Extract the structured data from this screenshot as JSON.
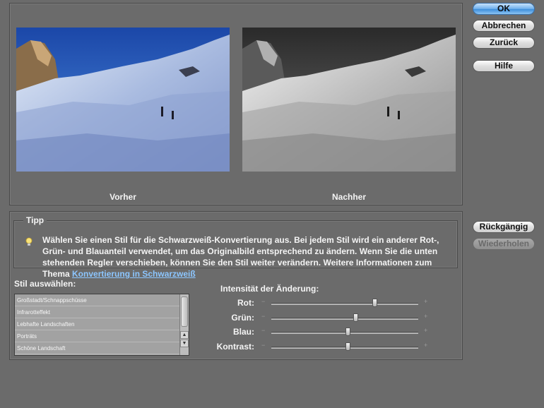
{
  "buttons": {
    "ok": "OK",
    "cancel": "Abbrechen",
    "back": "Zurück",
    "help": "Hilfe",
    "undo": "Rückgängig",
    "redo": "Wiederholen"
  },
  "preview": {
    "before_label": "Vorher",
    "after_label": "Nachher"
  },
  "tip": {
    "title": "Tipp",
    "text": "Wählen Sie einen Stil für die Schwarzweiß-Konvertierung aus. Bei jedem Stil wird ein anderer Rot-, Grün- und Blauanteil verwendet, um das Originalbild entsprechend zu ändern. Wenn Sie die unten stehenden Regler verschieben, können Sie den Stil weiter verändern. Weitere Informationen zum Thema ",
    "link": "Konvertierung in Schwarzweiß"
  },
  "style_select": {
    "label": "Stil auswählen:",
    "items": [
      "Großstadt/Schnappschüsse",
      "Infrarotteffekt",
      "Lebhafte Landschaften",
      "Porträts",
      "Schöne Landschaft"
    ]
  },
  "intensity": {
    "label": "Intensität der Änderung:",
    "sliders": [
      {
        "label": "Rot:",
        "value": 0.7
      },
      {
        "label": "Grün:",
        "value": 0.57
      },
      {
        "label": "Blau:",
        "value": 0.52
      },
      {
        "label": "Kontrast:",
        "value": 0.52
      }
    ],
    "minus_symbol": "−",
    "plus_symbol": "+"
  },
  "scroll": {
    "up": "▲",
    "down": "▼"
  },
  "colors": {
    "background": "#6b6b6b",
    "link": "#8cc6ff",
    "primary_button": "#5aa2e6"
  }
}
